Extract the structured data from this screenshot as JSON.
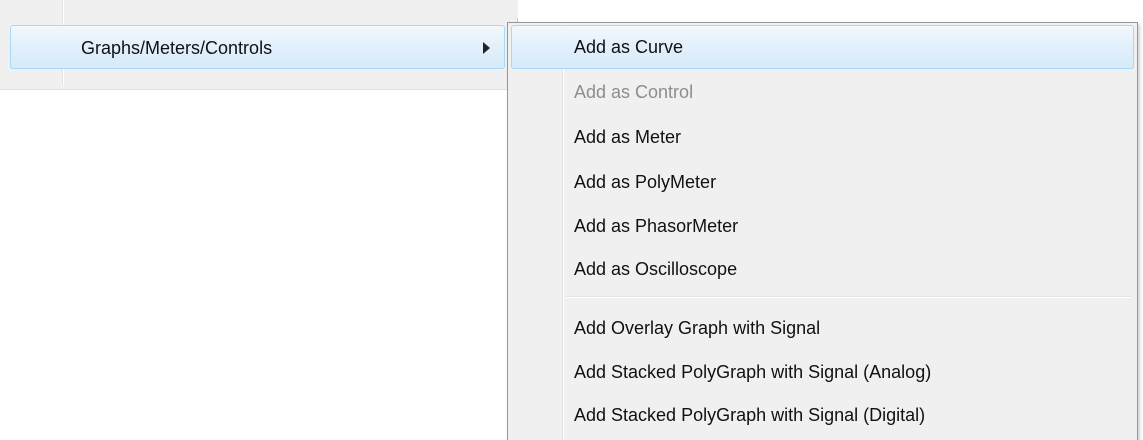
{
  "parent_menu": {
    "item_label": "Graphs/Meters/Controls"
  },
  "submenu": {
    "items": [
      {
        "label": "Add as Curve",
        "enabled": true,
        "highlighted": true
      },
      {
        "label": "Add as Control",
        "enabled": false,
        "highlighted": false
      },
      {
        "label": "Add as Meter",
        "enabled": true,
        "highlighted": false
      },
      {
        "label": "Add as PolyMeter",
        "enabled": true,
        "highlighted": false
      },
      {
        "label": "Add as PhasorMeter",
        "enabled": true,
        "highlighted": false
      },
      {
        "label": "Add as Oscilloscope",
        "enabled": true,
        "highlighted": false
      }
    ],
    "items_after_separator": [
      {
        "label": "Add Overlay Graph with Signal",
        "enabled": true
      },
      {
        "label": "Add Stacked PolyGraph with Signal (Analog)",
        "enabled": true
      },
      {
        "label": "Add Stacked PolyGraph with Signal (Digital)",
        "enabled": true
      }
    ]
  },
  "colors": {
    "menu_background": "#f0f0f0",
    "highlight_border": "#a8d8f5",
    "highlight_fill": "#e2f0fb",
    "disabled_text": "#8d8d8d",
    "text": "#111111"
  },
  "icons": {
    "submenu_arrow": "submenu-arrow-icon"
  }
}
